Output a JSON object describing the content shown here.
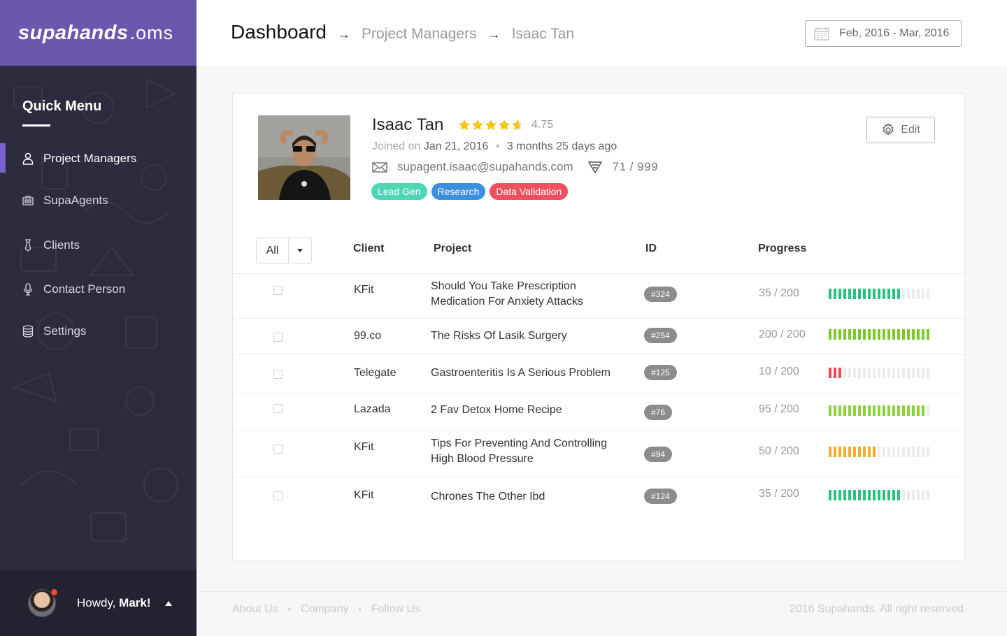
{
  "brand": {
    "bold": "supahands",
    "light": ".oms"
  },
  "sidebar": {
    "title": "Quick Menu",
    "items": [
      {
        "label": "Project Managers",
        "icon": "user-icon",
        "active": true
      },
      {
        "label": "SupaAgents",
        "icon": "agents-icon",
        "active": false
      },
      {
        "label": "Clients",
        "icon": "tie-icon",
        "active": false
      },
      {
        "label": "Contact Person",
        "icon": "microphone-icon",
        "active": false
      },
      {
        "label": "Settings",
        "icon": "database-icon",
        "active": false
      }
    ],
    "user": {
      "greeting": "Howdy,",
      "name": "Mark!"
    }
  },
  "header": {
    "breadcrumb": [
      "Dashboard",
      "Project Managers",
      "Isaac Tan"
    ],
    "date_range": "Feb, 2016 - Mar, 2016"
  },
  "profile": {
    "name": "Isaac Tan",
    "rating": "4.75",
    "rating_value": 4.75,
    "joined_label": "Joined on",
    "joined_date": "Jan 21, 2016",
    "joined_ago": "3 months 25 days ago",
    "email": "supagent.isaac@supahands.com",
    "task_count": "71 / 999",
    "edit_label": "Edit",
    "tags": [
      {
        "label": "Lead Gen",
        "color": "#4fd6b6"
      },
      {
        "label": "Research",
        "color": "#3d8ee0"
      },
      {
        "label": "Data Validation",
        "color": "#f0505e"
      }
    ]
  },
  "table": {
    "filter": "All",
    "headers": {
      "client": "Client",
      "project": "Project",
      "id": "ID",
      "progress": "Progress"
    },
    "rows": [
      {
        "client": "KFit",
        "project": "Should You Take Prescription Medication For Anxiety Attacks",
        "id": "#324",
        "score": "35 / 200",
        "filled": 15,
        "total": 21,
        "color": "#27c27e"
      },
      {
        "client": "99.co",
        "project": "The Risks Of Lasik Surgery",
        "id": "#254",
        "score": "200 / 200",
        "filled": 21,
        "total": 21,
        "color": "#7bc826"
      },
      {
        "client": "Telegate",
        "project": "Gastroenteritis Is A Serious Problem",
        "id": "#125",
        "score": "10 / 200",
        "filled": 3,
        "total": 21,
        "color": "#ee4852"
      },
      {
        "client": "Lazada",
        "project": "2 Fav Detox Home Recipe",
        "id": "#76",
        "score": "95 / 200",
        "filled": 20,
        "total": 21,
        "color": "#8bd339"
      },
      {
        "client": "KFit",
        "project": "Tips For Preventing And Controlling High Blood Pressure",
        "id": "#94",
        "score": "50 / 200",
        "filled": 10,
        "total": 21,
        "color": "#f6a92c"
      },
      {
        "client": "KFit",
        "project": "Chrones The Other Ibd",
        "id": "#124",
        "score": "35 / 200",
        "filled": 15,
        "total": 21,
        "color": "#27c27e"
      }
    ]
  },
  "footer": {
    "links": [
      "About Us",
      "Company",
      "Follow Us"
    ],
    "separator": "•",
    "copyright": "2016 Supahands. All right reserved"
  }
}
